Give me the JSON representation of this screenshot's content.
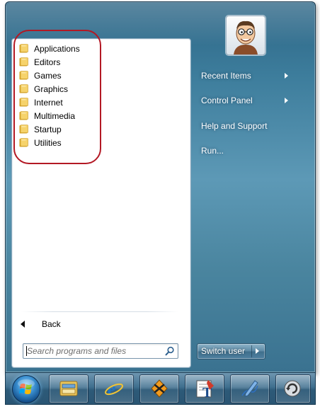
{
  "programs": {
    "items": [
      {
        "label": "Applications"
      },
      {
        "label": "Editors"
      },
      {
        "label": "Games"
      },
      {
        "label": "Graphics"
      },
      {
        "label": "Internet"
      },
      {
        "label": "Multimedia"
      },
      {
        "label": "Startup"
      },
      {
        "label": "Utilities"
      }
    ],
    "icon": "folder-icon"
  },
  "back": {
    "label": "Back"
  },
  "search": {
    "placeholder": "Search programs and files",
    "icon": "search-icon"
  },
  "right_menu": {
    "recent_items": "Recent Items",
    "control_panel": "Control Panel",
    "help_support": "Help and Support",
    "run": "Run..."
  },
  "switch_user": {
    "label": "Switch user"
  },
  "user": {
    "avatar": "cartoon-avatar"
  },
  "taskbar": {
    "start": "windows-orb-icon",
    "buttons": [
      {
        "icon": "file-manager-icon"
      },
      {
        "icon": "internet-explorer-icon"
      },
      {
        "icon": "media-player-icon"
      },
      {
        "icon": "text-editor-icon"
      },
      {
        "icon": "drawing-pen-icon"
      },
      {
        "icon": "refresh-icon"
      }
    ]
  },
  "colors": {
    "menu_blue": "#4a859f",
    "highlight_red": "#b31824",
    "panel_white": "#ffffff"
  }
}
